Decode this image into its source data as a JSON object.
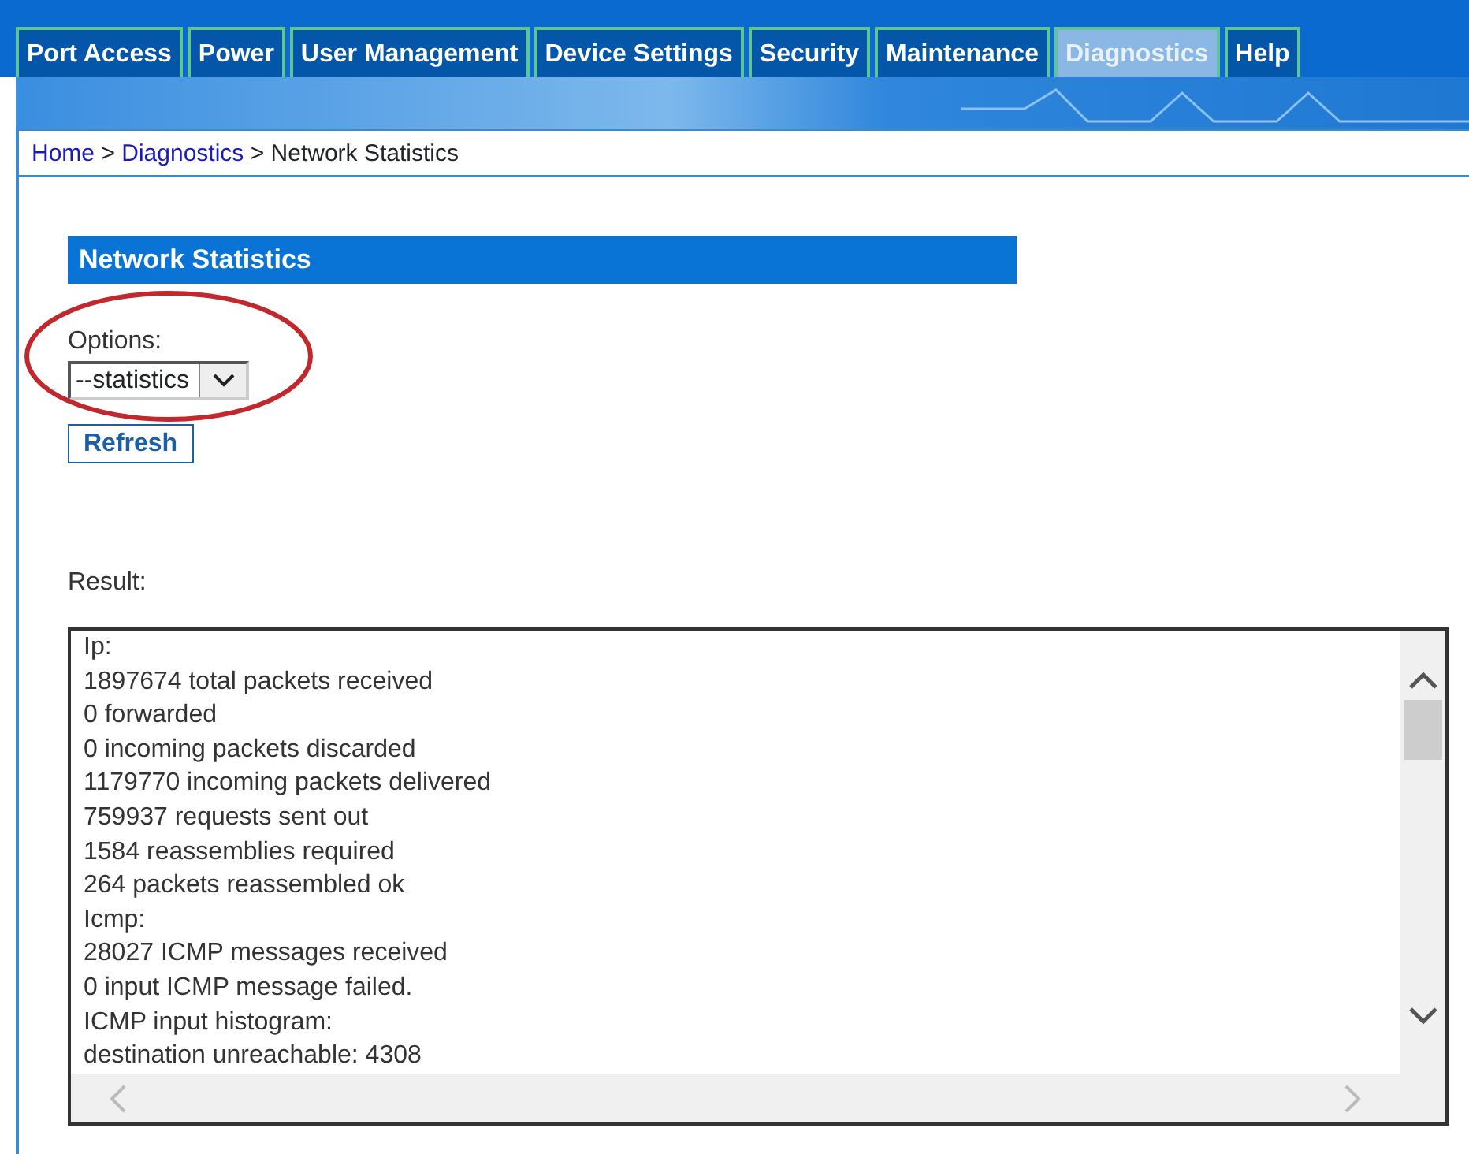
{
  "tabs": [
    {
      "label": "Port Access",
      "selected": false
    },
    {
      "label": "Power",
      "selected": false
    },
    {
      "label": "User Management",
      "selected": false
    },
    {
      "label": "Device Settings",
      "selected": false
    },
    {
      "label": "Security",
      "selected": false
    },
    {
      "label": "Maintenance",
      "selected": false
    },
    {
      "label": "Diagnostics",
      "selected": true
    },
    {
      "label": "Help",
      "selected": false
    }
  ],
  "breadcrumb": [
    {
      "text": "Home",
      "kind": "link"
    },
    {
      "text": ">",
      "kind": "separator"
    },
    {
      "text": "Diagnostics",
      "kind": "link"
    },
    {
      "text": ">",
      "kind": "separator"
    },
    {
      "text": "Network Statistics",
      "kind": "current"
    }
  ],
  "section": {
    "title": "Network Statistics",
    "options": {
      "label": "Options:",
      "value": "--statistics"
    },
    "refresh_button": "Refresh",
    "result": {
      "label": "Result:",
      "lines": [
        "Ip:",
        "1897674 total packets received",
        "0 forwarded",
        "0 incoming packets discarded",
        "1179770 incoming packets delivered",
        "759937 requests sent out",
        "1584 reassemblies required",
        "264 packets reassembled ok",
        "Icmp:",
        "28027 ICMP messages received",
        "0 input ICMP message failed.",
        "ICMP input histogram:",
        "destination unreachable: 4308"
      ]
    }
  }
}
